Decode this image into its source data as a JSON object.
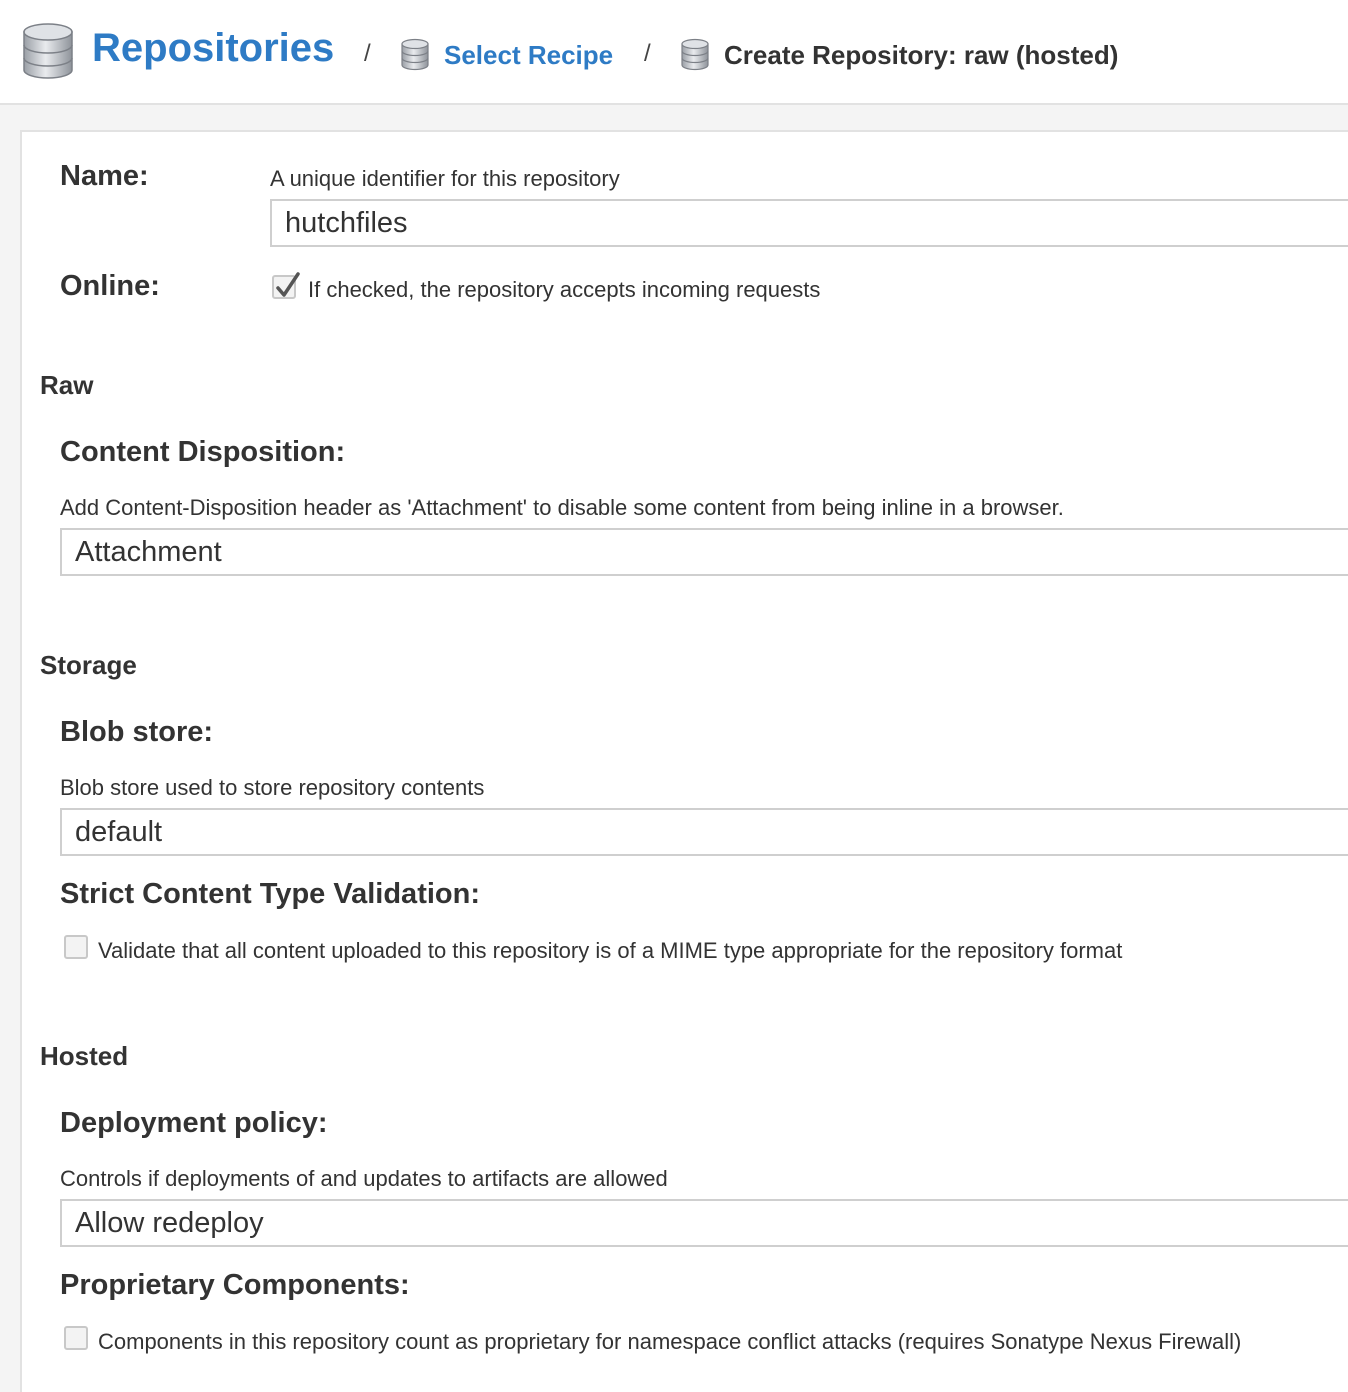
{
  "breadcrumb": {
    "root": "Repositories",
    "separator": "/",
    "step": "Select Recipe",
    "current": "Create Repository: raw (hosted)"
  },
  "form": {
    "name": {
      "label": "Name:",
      "help": "A unique identifier for this repository",
      "value": "hutchfiles"
    },
    "online": {
      "label": "Online:",
      "checked": true,
      "text": "If checked, the repository accepts incoming requests"
    },
    "raw": {
      "section": "Raw",
      "content_disposition": {
        "label": "Content Disposition:",
        "help": "Add Content-Disposition header as 'Attachment' to disable some content from being inline in a browser.",
        "value": "Attachment"
      }
    },
    "storage": {
      "section": "Storage",
      "blob_store": {
        "label": "Blob store:",
        "help": "Blob store used to store repository contents",
        "value": "default"
      },
      "strict_validation": {
        "label": "Strict Content Type Validation:",
        "checked": false,
        "text": "Validate that all content uploaded to this repository is of a MIME type appropriate for the repository format"
      }
    },
    "hosted": {
      "section": "Hosted",
      "deployment_policy": {
        "label": "Deployment policy:",
        "help": "Controls if deployments of and updates to artifacts are allowed",
        "value": "Allow redeploy"
      },
      "proprietary": {
        "label": "Proprietary Components:",
        "checked": false,
        "text": "Components in this repository count as proprietary for namespace conflict attacks (requires Sonatype Nexus Firewall)"
      }
    }
  },
  "icons": {
    "repository": "database-icon",
    "checkmark": "checkmark-icon"
  },
  "colors": {
    "link": "#2e7bc5",
    "text": "#333333",
    "border": "#cfcfcf"
  }
}
